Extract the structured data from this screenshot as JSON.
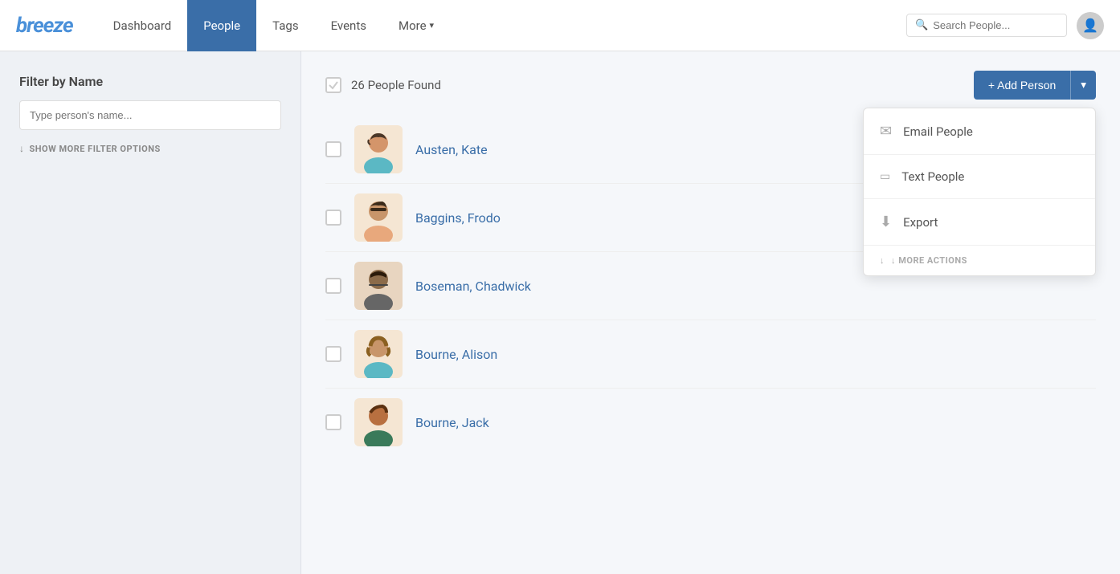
{
  "brand": "breeze",
  "nav": {
    "links": [
      {
        "id": "dashboard",
        "label": "Dashboard",
        "active": false
      },
      {
        "id": "people",
        "label": "People",
        "active": true
      },
      {
        "id": "tags",
        "label": "Tags",
        "active": false
      },
      {
        "id": "events",
        "label": "Events",
        "active": false
      },
      {
        "id": "more",
        "label": "More",
        "active": false,
        "hasChevron": true
      }
    ],
    "search_placeholder": "Search People..."
  },
  "sidebar": {
    "title": "Filter by Name",
    "input_placeholder": "Type person's name...",
    "show_more_label": "SHOW MORE FILTER OPTIONS"
  },
  "main": {
    "people_count_label": "26 People Found",
    "add_person_label": "+ Add Person",
    "add_person_dropdown_label": "▾"
  },
  "action_panel": {
    "items": [
      {
        "id": "email",
        "icon": "✉",
        "label": "Email People"
      },
      {
        "id": "text",
        "icon": "📱",
        "label": "Text People"
      },
      {
        "id": "export",
        "icon": "⬇",
        "label": "Export"
      }
    ],
    "more_actions_label": "↓ MORE ACTIONS"
  },
  "people": [
    {
      "id": 1,
      "name": "Austen, Kate",
      "avatar": "👩"
    },
    {
      "id": 2,
      "name": "Baggins, Frodo",
      "avatar": "🧑"
    },
    {
      "id": 3,
      "name": "Boseman, Chadwick",
      "avatar": "👨"
    },
    {
      "id": 4,
      "name": "Bourne, Alison",
      "avatar": "👩"
    },
    {
      "id": 5,
      "name": "Bourne, Jack",
      "avatar": "👦"
    }
  ]
}
